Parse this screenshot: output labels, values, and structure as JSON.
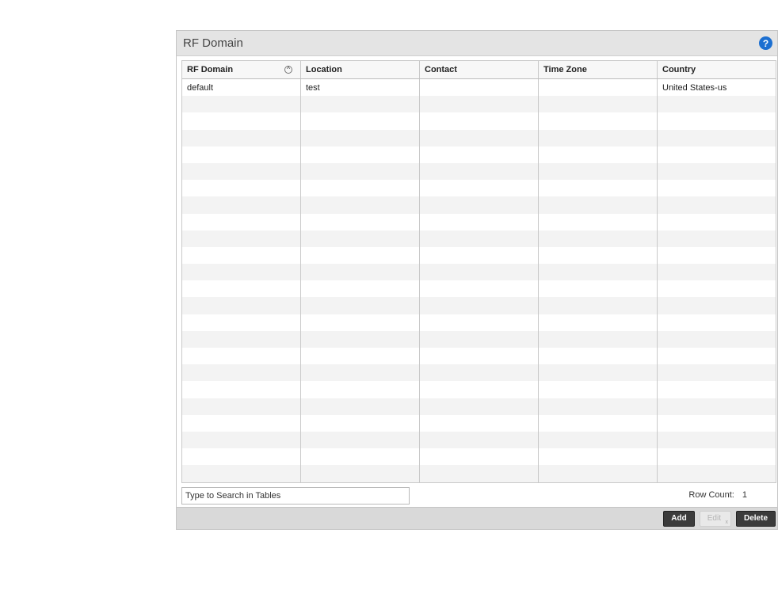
{
  "panel": {
    "title": "RF Domain",
    "help_icon": "question-mark-icon"
  },
  "table": {
    "columns": [
      "RF Domain",
      "Location",
      "Contact",
      "Time Zone",
      "Country"
    ],
    "sort_icon": "sort-ascending-icon",
    "rows": [
      [
        "default",
        "test",
        "",
        "",
        "United States-us"
      ]
    ]
  },
  "search": {
    "placeholder": "Type to Search in Tables"
  },
  "row_count": {
    "label": "Row Count:",
    "value": "1"
  },
  "buttons": {
    "add": "Add",
    "edit": "Edit",
    "delete": "Delete"
  },
  "colors": {
    "header_bg": "#e4e4e4",
    "help_blue": "#1c6fd1",
    "button_dark": "#3b3b3b"
  }
}
